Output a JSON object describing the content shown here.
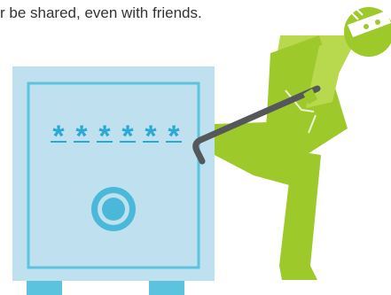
{
  "caption": {
    "text": "r be shared, even with friends."
  },
  "illustration": {
    "safe": {
      "password_mask": [
        "*",
        "*",
        "*",
        "*",
        "*",
        "*"
      ],
      "colors": {
        "body": "#bfe0ee",
        "trim": "#5cc3de",
        "asterisk": "#29a9d4",
        "dial": "#4ab8d9"
      }
    },
    "thief": {
      "colors": {
        "body": "#9ec92b",
        "body_light": "#b8d94e",
        "mask": "#ffffff",
        "crowbar": "#55585a"
      }
    },
    "icons": [
      "safe-icon",
      "thief-icon",
      "crowbar-icon",
      "dial-icon"
    ]
  }
}
